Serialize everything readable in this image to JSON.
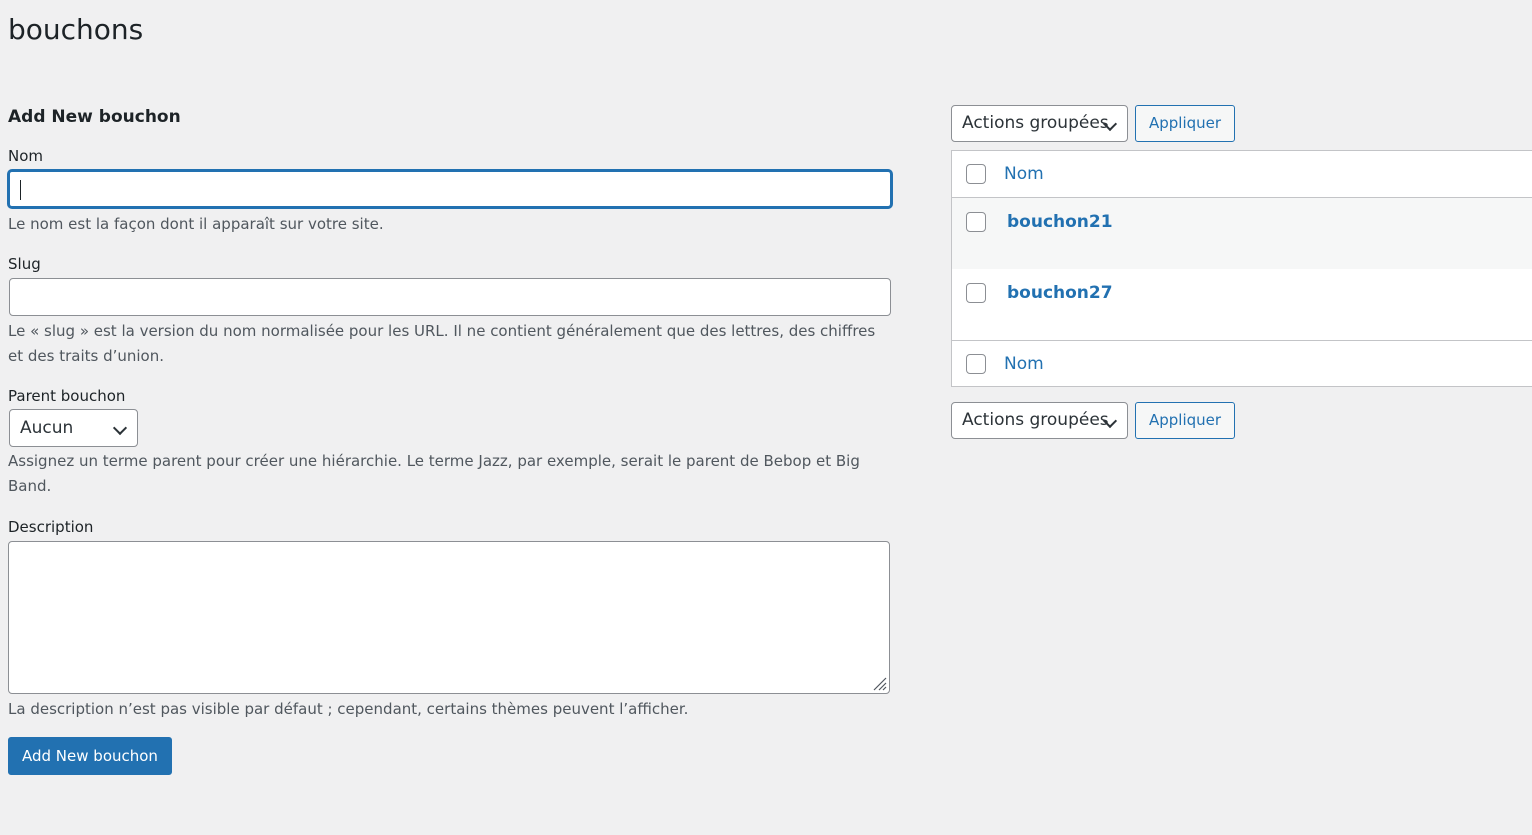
{
  "page": {
    "title": "bouchons"
  },
  "form": {
    "heading": "Add New bouchon",
    "name": {
      "label": "Nom",
      "value": "",
      "help": "Le nom est la façon dont il apparaît sur votre site."
    },
    "slug": {
      "label": "Slug",
      "value": "",
      "help": "Le « slug » est la version du nom normalisée pour les URL. Il ne contient généralement que des lettres, des chiffres et des traits d’union."
    },
    "parent": {
      "label": "Parent bouchon",
      "selected": "Aucun",
      "help": "Assignez un terme parent pour créer une hiérarchie. Le terme Jazz, par exemple, serait le parent de Bebop et Big Band."
    },
    "description": {
      "label": "Description",
      "value": "",
      "help": "La description n’est pas visible par défaut ; cependant, certains thèmes peuvent l’afficher."
    },
    "submit_label": "Add New bouchon"
  },
  "list": {
    "bulk_top": {
      "selected": "Actions groupées",
      "apply_label": "Appliquer"
    },
    "bulk_bottom": {
      "selected": "Actions groupées",
      "apply_label": "Appliquer"
    },
    "column_header": "Nom",
    "column_footer": "Nom",
    "rows": [
      {
        "name": "bouchon21"
      },
      {
        "name": "bouchon27"
      }
    ]
  },
  "colors": {
    "accent": "#2271b1",
    "background": "#f0f0f1",
    "text": "#1d2327",
    "muted": "#50575e"
  }
}
